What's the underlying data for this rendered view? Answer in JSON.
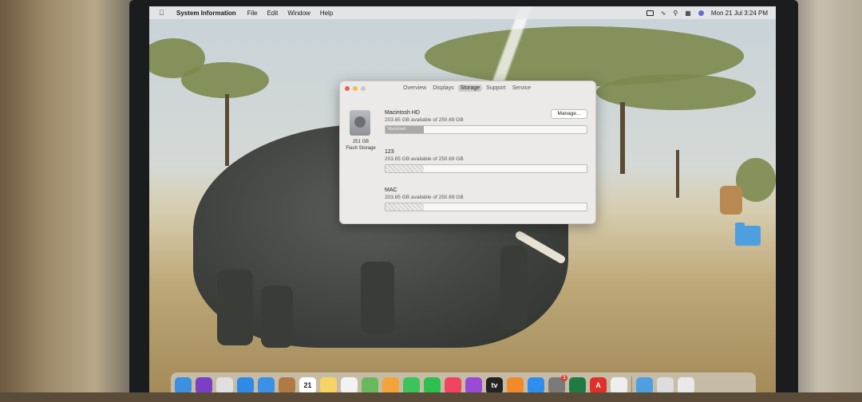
{
  "menubar": {
    "app_name": "System Information",
    "items": [
      "File",
      "Edit",
      "Window",
      "Help"
    ],
    "clock": "Mon 21 Jul  3:24 PM"
  },
  "window": {
    "tabs": [
      "Overview",
      "Displays",
      "Storage",
      "Support",
      "Service"
    ],
    "active_tab": "Storage",
    "drive": {
      "size": "251 GB",
      "type": "Flash Storage"
    },
    "manage_label": "Manage...",
    "volumes": [
      {
        "name": "Macintosh HD",
        "available": "203.85 GB available of 250.69 GB",
        "used_fraction": 0.19,
        "bar_label": "Macintosh"
      },
      {
        "name": "123",
        "available": "203.85 GB available of 250.69 GB",
        "used_fraction": 0.19
      },
      {
        "name": "MAC",
        "available": "203.85 GB available of 250.69 GB",
        "used_fraction": 0.19
      }
    ]
  },
  "dock": {
    "icons": [
      {
        "name": "finder-icon",
        "color": "#3d8fe0"
      },
      {
        "name": "siri-icon",
        "color": "#7a3fc2"
      },
      {
        "name": "launchpad-icon",
        "color": "#e0e0e0"
      },
      {
        "name": "safari-icon",
        "color": "#2f89e6"
      },
      {
        "name": "mail-icon",
        "color": "#3b90e8"
      },
      {
        "name": "contacts-icon",
        "color": "#b07a44"
      },
      {
        "name": "calendar-icon",
        "color": "#ffffff",
        "label": "21"
      },
      {
        "name": "notes-icon",
        "color": "#f6d364"
      },
      {
        "name": "reminders-icon",
        "color": "#f2f2f2"
      },
      {
        "name": "maps-icon",
        "color": "#69b85c"
      },
      {
        "name": "photos-icon",
        "color": "#f4a23a"
      },
      {
        "name": "messages-icon",
        "color": "#3cc35a"
      },
      {
        "name": "facetime-icon",
        "color": "#2fbf4e"
      },
      {
        "name": "music-icon",
        "color": "#f24360"
      },
      {
        "name": "podcasts-icon",
        "color": "#9b4ad6"
      },
      {
        "name": "appletv-icon",
        "color": "#222222",
        "label": "tv"
      },
      {
        "name": "books-icon",
        "color": "#f08a2a"
      },
      {
        "name": "appstore-icon",
        "color": "#2e8ef0"
      },
      {
        "name": "system-preferences-icon",
        "color": "#7a7a7a",
        "badge": "1"
      },
      {
        "name": "excel-icon",
        "color": "#1f7a44"
      },
      {
        "name": "acrobat-icon",
        "color": "#e0302a",
        "label": "A"
      },
      {
        "name": "preview-icon",
        "color": "#eeeeee"
      },
      {
        "name": "folder-icon",
        "color": "#4e9fe0"
      },
      {
        "name": "screenshot-icon",
        "color": "#dddddd"
      },
      {
        "name": "trash-icon",
        "color": "#e9e9e9"
      }
    ]
  }
}
